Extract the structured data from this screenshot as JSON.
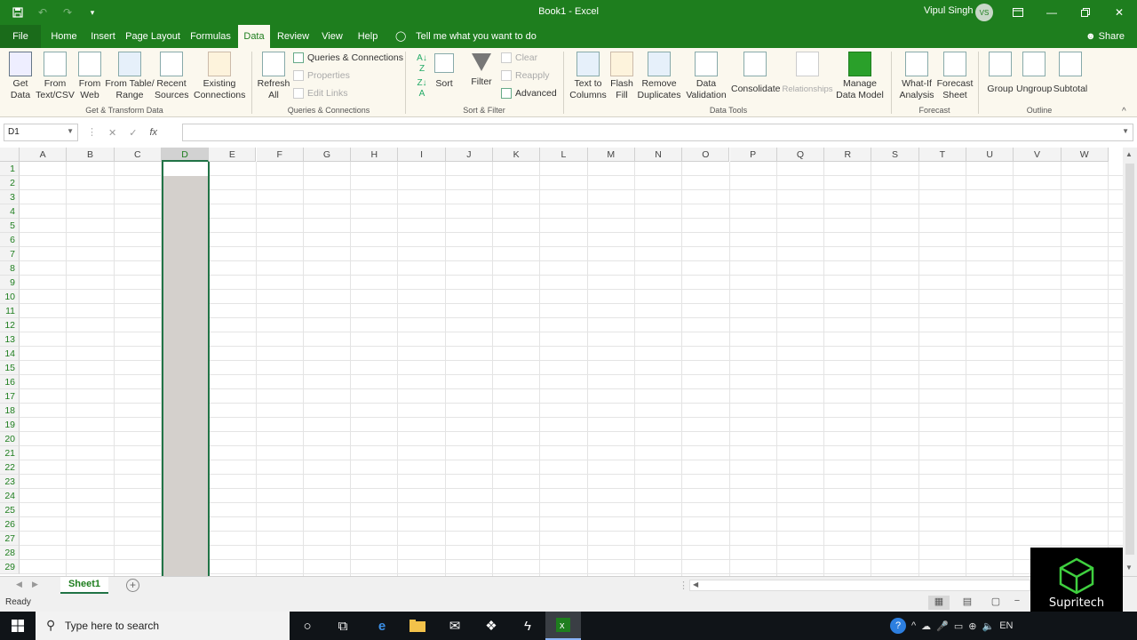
{
  "window": {
    "title": "Book1 - Excel",
    "user_name": "Vipul Singh",
    "user_initials": "VS"
  },
  "tabs": [
    {
      "label": "File"
    },
    {
      "label": "Home"
    },
    {
      "label": "Insert"
    },
    {
      "label": "Page Layout"
    },
    {
      "label": "Formulas"
    },
    {
      "label": "Data"
    },
    {
      "label": "Review"
    },
    {
      "label": "View"
    },
    {
      "label": "Help"
    }
  ],
  "tell_me": "Tell me what you want to do",
  "share_label": "Share",
  "ribbon": {
    "get_data": "Get\nData",
    "from_text_csv": "From\nText/CSV",
    "from_web": "From\nWeb",
    "from_table_range": "From Table/\nRange",
    "recent_sources": "Recent\nSources",
    "existing_connections": "Existing\nConnections",
    "refresh_all": "Refresh\nAll",
    "queries_connections": "Queries & Connections",
    "properties": "Properties",
    "edit_links": "Edit Links",
    "sort": "Sort",
    "filter": "Filter",
    "clear": "Clear",
    "reapply": "Reapply",
    "advanced": "Advanced",
    "text_to_columns": "Text to\nColumns",
    "flash_fill": "Flash\nFill",
    "remove_duplicates": "Remove\nDuplicates",
    "data_validation": "Data\nValidation",
    "consolidate": "Consolidate",
    "relationships": "Relationships",
    "manage_data_model": "Manage\nData Model",
    "what_if_analysis": "What-If\nAnalysis",
    "forecast_sheet": "Forecast\nSheet",
    "group": "Group",
    "ungroup": "Ungroup",
    "subtotal": "Subtotal",
    "groups": {
      "get_transform": "Get & Transform Data",
      "queries_connections": "Queries & Connections",
      "sort_filter": "Sort & Filter",
      "data_tools": "Data Tools",
      "forecast": "Forecast",
      "outline": "Outline"
    }
  },
  "formula_bar": {
    "name_box": "D1",
    "fx": "fx",
    "formula": ""
  },
  "grid": {
    "columns": [
      "A",
      "B",
      "C",
      "D",
      "E",
      "F",
      "G",
      "H",
      "I",
      "J",
      "K",
      "L",
      "M",
      "N",
      "O",
      "P",
      "Q",
      "R",
      "S",
      "T",
      "U",
      "V",
      "W"
    ],
    "selected_column": "D",
    "rows": [
      "1",
      "2",
      "3",
      "4",
      "5",
      "6",
      "7",
      "8",
      "9",
      "10",
      "11",
      "12",
      "13",
      "14",
      "15",
      "16",
      "17",
      "18",
      "19",
      "20",
      "21",
      "22",
      "23",
      "24",
      "25",
      "26",
      "27",
      "28",
      "29"
    ]
  },
  "sheets": [
    {
      "label": "Sheet1"
    }
  ],
  "status": "Ready",
  "watermark": "Supritech",
  "taskbar": {
    "search_placeholder": "Type here to search",
    "language": "EN"
  },
  "colors": {
    "excel_green": "#1e7e1e",
    "ribbon_bg": "#fbf8ee",
    "selection": "#217346"
  }
}
